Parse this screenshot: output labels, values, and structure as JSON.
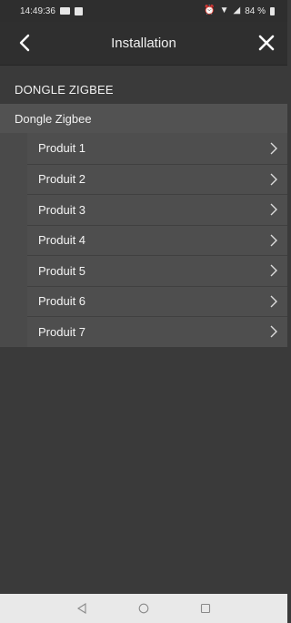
{
  "status_bar": {
    "time": "14:49:36",
    "battery": "84 %"
  },
  "app_bar": {
    "title": "Installation"
  },
  "section": {
    "title": "DONGLE ZIGBEE"
  },
  "group": {
    "title": "Dongle Zigbee"
  },
  "products": [
    {
      "label": "Produit 1"
    },
    {
      "label": "Produit 2"
    },
    {
      "label": "Produit 3"
    },
    {
      "label": "Produit 4"
    },
    {
      "label": "Produit 5"
    },
    {
      "label": "Produit 6"
    },
    {
      "label": "Produit 7"
    }
  ],
  "colors": {
    "background": "#3a3a3a",
    "appbar": "#2f2f2f",
    "group": "#525252",
    "item": "#4e4e4e",
    "navbar": "#e9e9e9"
  },
  "icons": {
    "back": "chevron-left-icon",
    "close": "close-icon",
    "item_arrow": "chevron-right-icon",
    "nav_back": "triangle-back-icon",
    "nav_home": "circle-home-icon",
    "nav_recents": "square-recents-icon"
  }
}
